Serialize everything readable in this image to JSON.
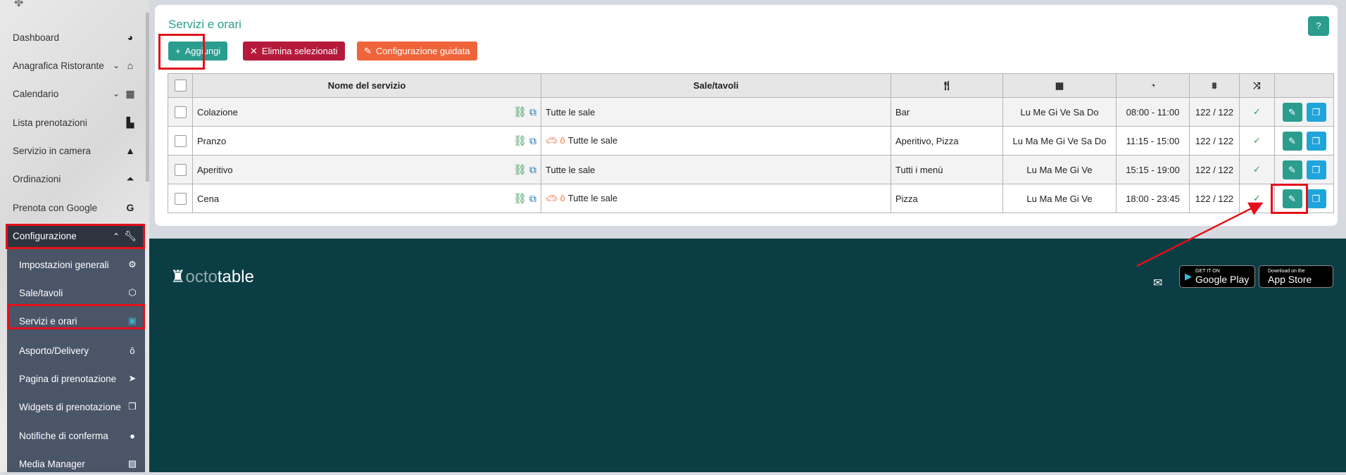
{
  "sidebar": {
    "items": [
      {
        "label": "Dashboard",
        "icon": "dashboard-icon"
      },
      {
        "label": "Anagrafica Ristorante",
        "icon": "home-icon"
      },
      {
        "label": "Calendario",
        "icon": "calendar-icon"
      },
      {
        "label": "Lista prenotazioni",
        "icon": "book-icon"
      },
      {
        "label": "Servizio in camera",
        "icon": "bell-icon"
      },
      {
        "label": "Ordinazioni",
        "icon": "concierge-bell-icon"
      },
      {
        "label": "Prenota con Google",
        "icon": "google-icon"
      }
    ],
    "config": {
      "label": "Configurazione",
      "icon": "wrench-icon"
    },
    "submenu": [
      {
        "label": "Impostazioni generali"
      },
      {
        "label": "Sale/tavoli"
      },
      {
        "label": "Servizi e orari"
      },
      {
        "label": "Asporto/Delivery"
      },
      {
        "label": "Pagina di prenotazione"
      },
      {
        "label": "Widgets di prenotazione"
      },
      {
        "label": "Notifiche di conferma"
      },
      {
        "label": "Media Manager"
      }
    ]
  },
  "page": {
    "title": "Servizi e orari",
    "help": "?",
    "buttons": {
      "add": "Aggiungi",
      "delete": "Elimina selezionati",
      "wizard": "Configurazione guidata"
    }
  },
  "table": {
    "headers": {
      "name": "Nome del servizio",
      "rooms": "Sale/tavoli"
    },
    "rows": [
      {
        "name": "Colazione",
        "rooms": "Tutte le sale",
        "delivery": false,
        "menu": "Bar",
        "days": "Lu Me Gi Ve Sa Do",
        "hours": "08:00 - 11:00",
        "seats": "122 / 122"
      },
      {
        "name": "Pranzo",
        "rooms": "Tutte le sale",
        "delivery": true,
        "menu": "Aperitivo, Pizza",
        "days": "Lu Ma Me Gi Ve Sa Do",
        "hours": "11:15 - 15:00",
        "seats": "122 / 122"
      },
      {
        "name": "Aperitivo",
        "rooms": "Tutte le sale",
        "delivery": false,
        "menu": "Tutti i menù",
        "days": "Lu Ma Me Gi Ve",
        "hours": "15:15 - 19:00",
        "seats": "122 / 122"
      },
      {
        "name": "Cena",
        "rooms": "Tutte le sale",
        "delivery": true,
        "menu": "Pizza",
        "days": "Lu Ma Me Gi Ve",
        "hours": "18:00 - 23:45",
        "seats": "122 / 122"
      }
    ]
  },
  "footer": {
    "logo_a": "octo",
    "logo_b": "table",
    "google_small": "GET IT ON",
    "google_big": "Google Play",
    "apple_small": "Download on the",
    "apple_big": "App Store"
  },
  "colors": {
    "teal": "#2a9d8f",
    "red": "#b5193b",
    "orange": "#f0643a",
    "blue": "#1fa5dc",
    "footer": "#0a3e44"
  }
}
